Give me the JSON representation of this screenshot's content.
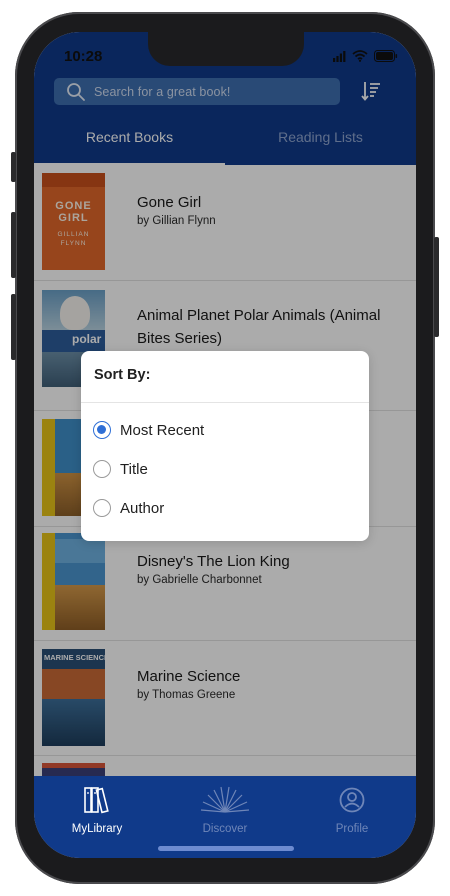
{
  "status_bar": {
    "time": "10:28"
  },
  "search": {
    "placeholder": "Search for a great book!"
  },
  "tabs": [
    {
      "label": "Recent Books",
      "active": true
    },
    {
      "label": "Reading Lists",
      "active": false
    }
  ],
  "books": [
    {
      "title": "Gone Girl",
      "author": "by Gillian Flynn"
    },
    {
      "title": "Animal Planet Polar Animals (Animal Bites Series)",
      "author": ""
    },
    {
      "title": "",
      "author": ""
    },
    {
      "title": "Disney's The Lion King",
      "author": "by Gabrielle Charbonnet"
    },
    {
      "title": "Marine Science",
      "author": "by Thomas Greene"
    }
  ],
  "cover_text": {
    "gone_girl": [
      "GONE",
      "GIRL",
      "GILLIAN",
      "FLYNN"
    ],
    "polar": "polar",
    "marine": "MARINE SCIENCE"
  },
  "sort_dialog": {
    "title": "Sort By:",
    "options": [
      {
        "label": "Most Recent",
        "selected": true
      },
      {
        "label": "Title",
        "selected": false
      },
      {
        "label": "Author",
        "selected": false
      }
    ]
  },
  "bottom_nav": [
    {
      "label": "MyLibrary",
      "icon": "library-books-icon",
      "active": true
    },
    {
      "label": "Discover",
      "icon": "discover-fan-icon",
      "active": false
    },
    {
      "label": "Profile",
      "icon": "profile-icon",
      "active": false
    }
  ],
  "colors": {
    "primary": "#103a8a",
    "search_bg": "#3e6fb0",
    "radio_selected": "#2f6fd6"
  }
}
